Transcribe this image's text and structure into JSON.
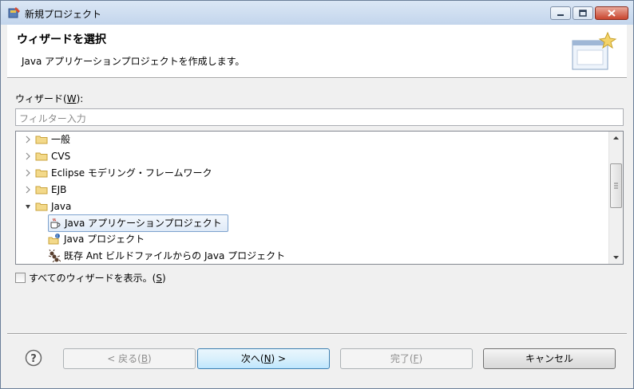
{
  "window": {
    "title": "新規プロジェクト",
    "icon": "new-project-wizard-icon"
  },
  "header": {
    "title": "ウィザードを選択",
    "description": "Java アプリケーションプロジェクトを作成します。",
    "banner_icon": "wizard-banner-icon"
  },
  "wizards": {
    "label_prefix": "ウィザード(",
    "label_mnemonic": "W",
    "label_suffix": "):",
    "filter_placeholder": "フィルター入力"
  },
  "tree": {
    "items": [
      {
        "label": "一般",
        "icon": "folder-icon",
        "expanded": false
      },
      {
        "label": "CVS",
        "icon": "folder-icon",
        "expanded": false
      },
      {
        "label": "Eclipse モデリング・フレームワーク",
        "icon": "folder-icon",
        "expanded": false
      },
      {
        "label": "EJB",
        "icon": "folder-icon",
        "expanded": false
      },
      {
        "label": "Java",
        "icon": "folder-icon",
        "expanded": true
      }
    ],
    "java_children": [
      {
        "label": "Java アプリケーションプロジェクト",
        "icon": "java-app-project-icon",
        "selected": true
      },
      {
        "label": "Java プロジェクト",
        "icon": "java-project-icon",
        "selected": false
      },
      {
        "label": "既存 Ant ビルドファイルからの Java プロジェクト",
        "icon": "ant-build-icon",
        "selected": false
      }
    ]
  },
  "show_all": {
    "label_prefix": "すべてのウィザードを表示。(",
    "label_mnemonic": "S",
    "label_suffix": ")",
    "checked": false
  },
  "buttons": {
    "back": {
      "prefix": "< 戻る(",
      "mnemonic": "B",
      "suffix": ")",
      "enabled": false
    },
    "next": {
      "prefix": "次へ(",
      "mnemonic": "N",
      "suffix": ") >",
      "enabled": true
    },
    "finish": {
      "prefix": "完了(",
      "mnemonic": "F",
      "suffix": ")",
      "enabled": false
    },
    "cancel": {
      "label": "キャンセル",
      "enabled": true
    }
  },
  "colors": {
    "selection_border": "#7da2ce",
    "default_button_border": "#3c7fb1",
    "folder": "#e8c35a"
  }
}
